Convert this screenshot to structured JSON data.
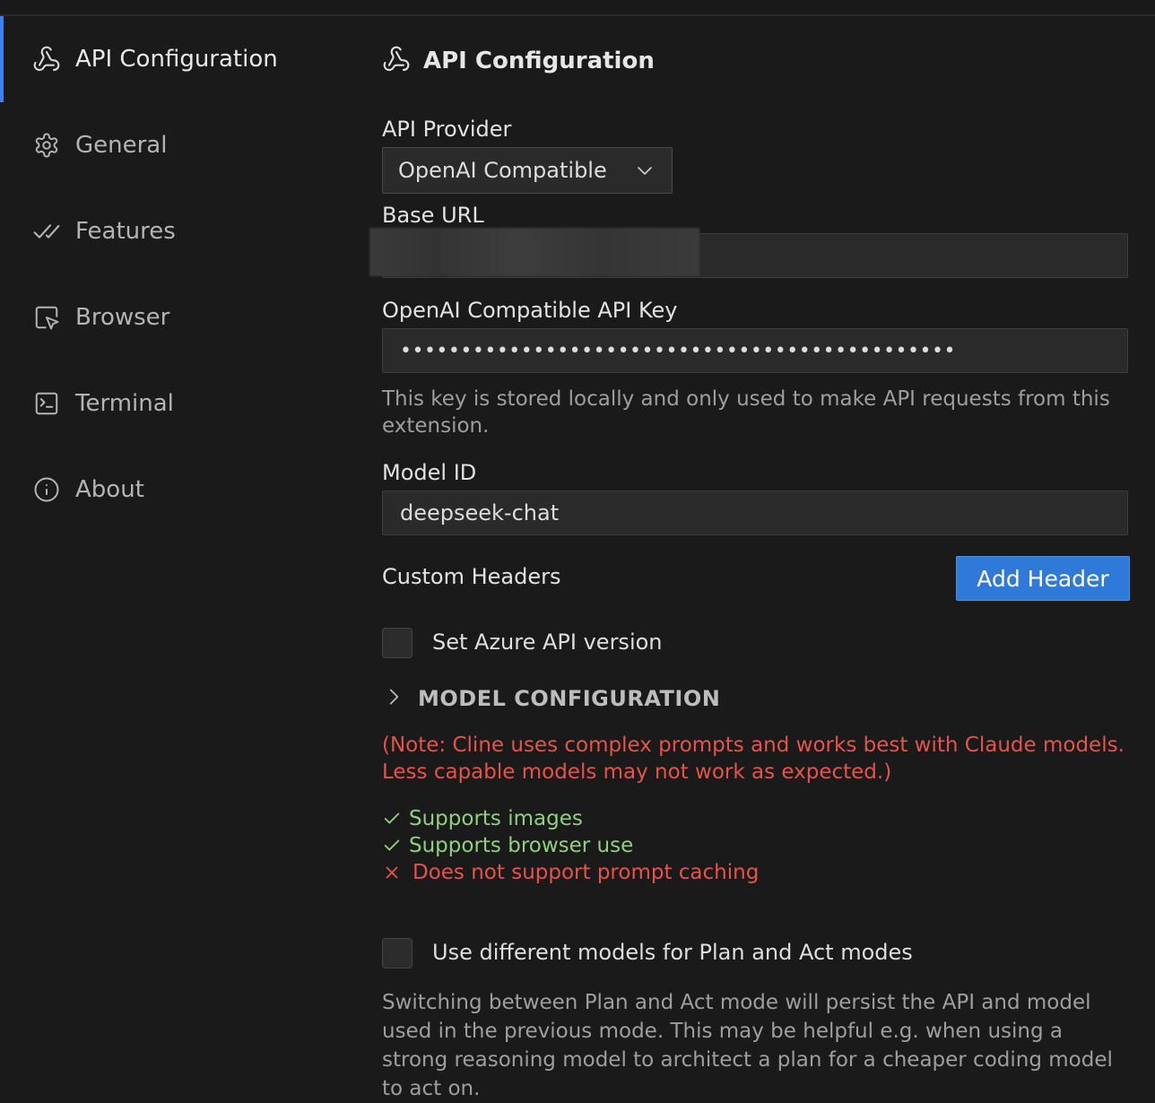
{
  "sidebar": {
    "items": [
      {
        "label": "API Configuration",
        "icon": "webhook-icon",
        "active": true
      },
      {
        "label": "General",
        "icon": "gear-icon",
        "active": false
      },
      {
        "label": "Features",
        "icon": "double-check-icon",
        "active": false
      },
      {
        "label": "Browser",
        "icon": "browser-pointer-icon",
        "active": false
      },
      {
        "label": "Terminal",
        "icon": "terminal-icon",
        "active": false
      },
      {
        "label": "About",
        "icon": "info-icon",
        "active": false
      }
    ]
  },
  "main": {
    "title": "API Configuration",
    "title_icon": "webhook-icon",
    "api_provider": {
      "label": "API Provider",
      "value": "OpenAI Compatible"
    },
    "base_url": {
      "label": "Base URL",
      "value": ""
    },
    "api_key": {
      "label": "OpenAI Compatible API Key",
      "value": "••••••••••••••••••••••••••••••••••••••••••••••",
      "help": "This key is stored locally and only used to make API requests from this extension."
    },
    "model_id": {
      "label": "Model ID",
      "value": "deepseek-chat"
    },
    "custom_headers": {
      "label": "Custom Headers",
      "button": "Add Header"
    },
    "azure": {
      "label": "Set Azure API version",
      "checked": false
    },
    "model_config": {
      "label": "MODEL CONFIGURATION",
      "expanded": false
    },
    "note": {
      "prefix": "(Note:",
      "text": " Cline uses complex prompts and works best with Claude models. Less capable models may not work as expected.)"
    },
    "capabilities": [
      {
        "label": "Supports images",
        "supported": true
      },
      {
        "label": "Supports browser use",
        "supported": true
      },
      {
        "label": "Does not support prompt caching",
        "supported": false
      }
    ],
    "plan_act": {
      "label": "Use different models for Plan and Act modes",
      "checked": false,
      "help": "Switching between Plan and Act mode will persist the API and model used in the previous mode. This may be helpful e.g. when using a strong reasoning model to architect a plan for a cheaper coding model to act on."
    }
  },
  "colors": {
    "accent": "#3b82f6",
    "button": "#2f7ad9",
    "error": "#e5534b",
    "success": "#8fd07f",
    "background": "#1a1a1a"
  }
}
